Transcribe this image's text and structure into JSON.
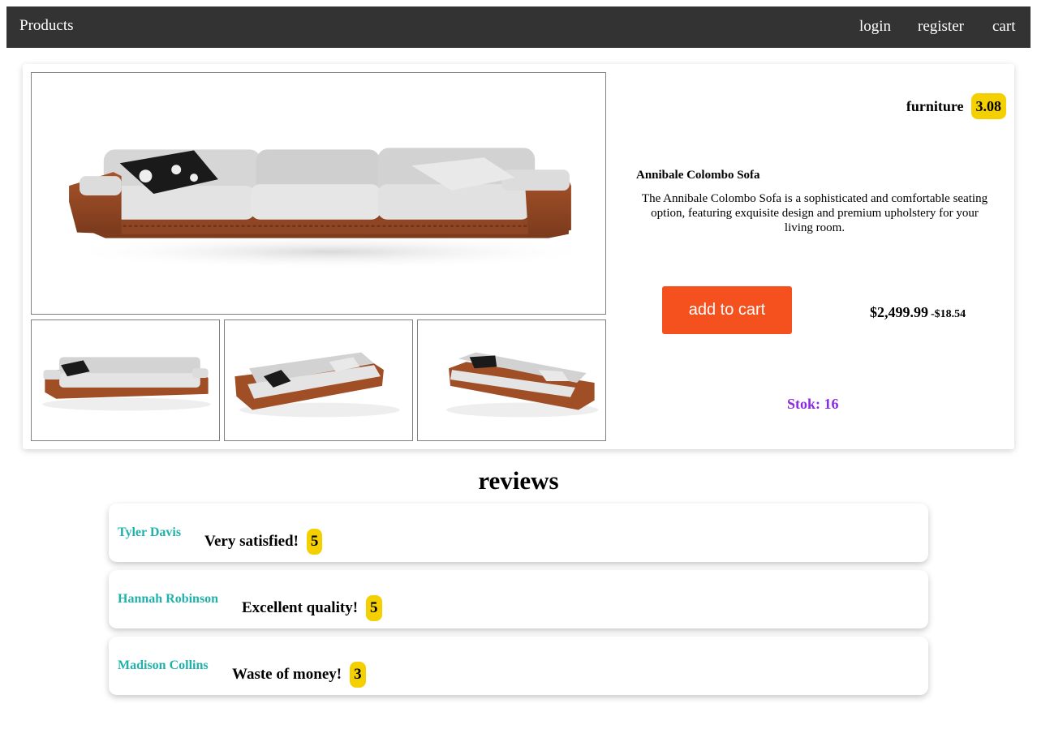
{
  "nav": {
    "brand": "Products",
    "login": "login",
    "register": "register",
    "cart": "cart"
  },
  "product": {
    "category": "furniture",
    "rating": "3.08",
    "name": "Annibale Colombo Sofa",
    "description": "The Annibale Colombo Sofa is a sophisticated and comfortable seating option, featuring exquisite design and premium upholstery for your living room.",
    "add_to_cart": "add to cart",
    "price": "$2,499.99",
    "discount": "-$18.54",
    "stock": "Stok: 16"
  },
  "reviews": {
    "title": "reviews",
    "items": [
      {
        "author": "Tyler Davis",
        "comment": "Very satisfied!",
        "score": "5"
      },
      {
        "author": "Hannah Robinson",
        "comment": "Excellent quality!",
        "score": "5"
      },
      {
        "author": "Madison Collins",
        "comment": "Waste of money!",
        "score": "3"
      }
    ]
  },
  "colors": {
    "navbar": "#333333",
    "accent_button": "#f4511e",
    "badge": "#f5d000",
    "author": "#20b2aa",
    "stock": "#8a2be2"
  }
}
